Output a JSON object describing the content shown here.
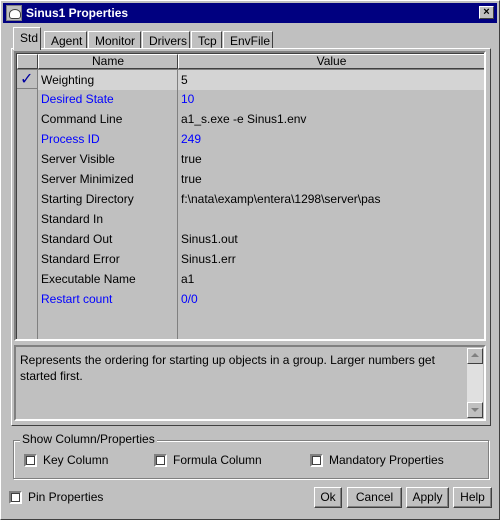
{
  "window": {
    "title": "Sinus1 Properties",
    "close_glyph": "×",
    "icon": "java-cup-icon"
  },
  "tabs": [
    {
      "label": "Std",
      "active": true
    },
    {
      "label": "Agent"
    },
    {
      "label": "Monitor"
    },
    {
      "label": "Drivers"
    },
    {
      "label": "Tcp"
    },
    {
      "label": "EnvFile"
    }
  ],
  "table": {
    "columns": [
      "Name",
      "Value"
    ],
    "rows": [
      {
        "name": "Weighting",
        "value": "5",
        "checked": true,
        "selected": true
      },
      {
        "name": "Desired State",
        "value": "10",
        "highlight": true
      },
      {
        "name": "Command Line",
        "value": "a1_s.exe -e Sinus1.env"
      },
      {
        "name": "Process ID",
        "value": "249",
        "highlight": true
      },
      {
        "name": "Server Visible",
        "value": "true"
      },
      {
        "name": "Server Minimized",
        "value": "true"
      },
      {
        "name": "Starting Directory",
        "value": "f:\\nata\\examp\\entera\\1298\\server\\pas"
      },
      {
        "name": "Standard In",
        "value": ""
      },
      {
        "name": "Standard Out",
        "value": "Sinus1.out"
      },
      {
        "name": "Standard Error",
        "value": "Sinus1.err"
      },
      {
        "name": "Executable Name",
        "value": "a1"
      },
      {
        "name": "Restart count",
        "value": "0/0",
        "highlight": true
      }
    ]
  },
  "description": "Represents the ordering for starting up objects in a group. Larger numbers get started first.",
  "show_group": {
    "title": "Show Column/Properties",
    "options": [
      {
        "label": "Key Column",
        "checked": false
      },
      {
        "label": "Formula Column",
        "checked": false
      },
      {
        "label": "Mandatory Properties",
        "checked": false
      }
    ]
  },
  "pin_properties": {
    "label": "Pin Properties",
    "checked": false
  },
  "buttons": {
    "ok": "Ok",
    "cancel": "Cancel",
    "apply": "Apply",
    "help": "Help"
  },
  "colors": {
    "titlebar": "#000080",
    "highlight_text": "#0000ff",
    "face": "#c0c0c0"
  }
}
